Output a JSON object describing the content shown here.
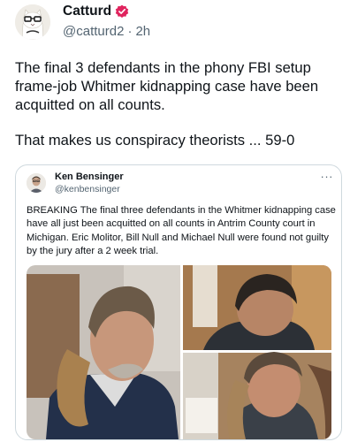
{
  "tweet": {
    "author_name": "Catturd",
    "author_handle": "@catturd2",
    "separator": "·",
    "time": "2h",
    "verified_icon": "verified-badge-icon",
    "text_p1": "The final 3 defendants in the phony FBI setup frame-job Whitmer kidnapping case have been acquitted on all counts.",
    "text_p2": "That makes us conspiracy theorists ... 59-0"
  },
  "quote": {
    "author_name": "Ken Bensinger",
    "author_handle": "@kenbensinger",
    "more_label": "···",
    "text": "BREAKING The final three defendants in the Whitmer kidnapping case have all just been acquitted on all counts in Antrim County court in Michigan. Eric Molitor, Bill Null and Michael Null were found not guilty by the jury after a 2 week trial.",
    "media_photos": [
      "courtroom-photo-left",
      "courtroom-photo-top-right",
      "courtroom-photo-bottom-right"
    ]
  },
  "colors": {
    "text": "#0f1419",
    "secondary": "#536471",
    "border": "#cfd9de",
    "verified": "#e0245e"
  }
}
